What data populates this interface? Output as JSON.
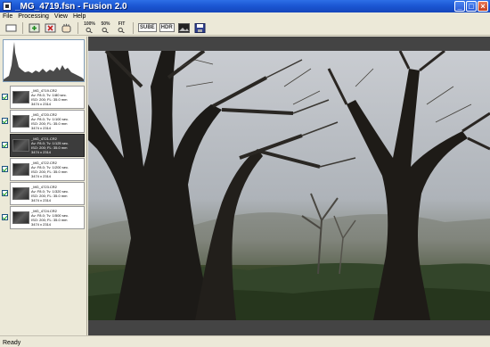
{
  "window": {
    "title": "_MG_4719.fsn - Fusion 2.0"
  },
  "menu": [
    "File",
    "Processing",
    "View",
    "Help"
  ],
  "toolbar": {
    "zoom100_label": "100%",
    "zoom50_label": "50%",
    "zoomfit_label": "FIT",
    "sube_label": "SUBE",
    "hdr_label": "HDR"
  },
  "thumbnails": [
    {
      "name": "_MG_4719.CR2",
      "exposure": "Av: F8.0; Tv: 1/80 sec.",
      "iso": "ISO: 200; FL: 35.0 mm",
      "size": "3474 x 2314",
      "checked": true,
      "selected": false
    },
    {
      "name": "_MG_4720.CR2",
      "exposure": "Av: F8.0; Tv: 1/100 sec.",
      "iso": "ISO: 200; FL: 35.0 mm",
      "size": "3474 x 2314",
      "checked": true,
      "selected": false
    },
    {
      "name": "_MG_4721.CR2",
      "exposure": "Av: F8.0; Tv: 1/125 sec.",
      "iso": "ISO: 200; FL: 35.0 mm",
      "size": "3474 x 2314",
      "checked": true,
      "selected": true
    },
    {
      "name": "_MG_4722.CR2",
      "exposure": "Av: F8.0; Tv: 1/200 sec.",
      "iso": "ISO: 200; FL: 35.0 mm",
      "size": "3474 x 2314",
      "checked": true,
      "selected": false
    },
    {
      "name": "_MG_4723.CR2",
      "exposure": "Av: F8.0; Tv: 1/320 sec.",
      "iso": "ISO: 200; FL: 35.0 mm",
      "size": "3474 x 2314",
      "checked": true,
      "selected": false
    },
    {
      "name": "_MG_4724.CR2",
      "exposure": "Av: F8.0; Tv: 1/500 sec.",
      "iso": "ISO: 200; FL: 35.0 mm",
      "size": "3474 x 2314",
      "checked": true,
      "selected": false
    }
  ],
  "status": {
    "text": "Ready"
  },
  "icons": {
    "toolbar": [
      "new-icon",
      "add-icon",
      "remove-icon",
      "hand-icon",
      "zoom-100-icon",
      "zoom-50-icon",
      "zoom-fit-icon",
      "sube-icon",
      "hdr-icon",
      "image-icon",
      "save-icon"
    ]
  },
  "colors": {
    "titlebar": "#1a55d2",
    "selected_thumb": "#3c3c3c",
    "preview_bg": "#444444"
  }
}
